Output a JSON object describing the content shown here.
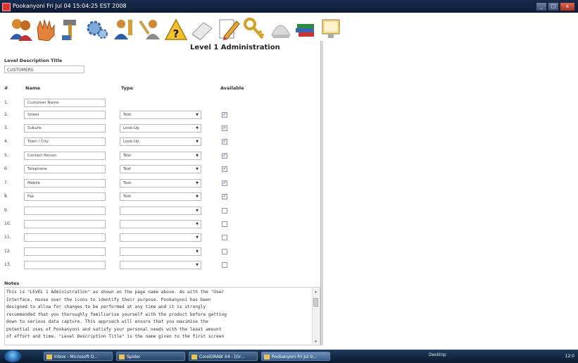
{
  "window": {
    "title": "Pookanyoni Fri Jul 04 15:04:25 EST 2008"
  },
  "toolbar": {
    "icons": [
      {
        "name": "users-icon"
      },
      {
        "name": "hand-icon"
      },
      {
        "name": "hammer-icon"
      },
      {
        "name": "gears-icon"
      },
      {
        "name": "user-gear-icon"
      },
      {
        "name": "user-tools-icon"
      },
      {
        "name": "help-warning-icon"
      },
      {
        "name": "eraser-icon"
      },
      {
        "name": "notepad-pencil-icon"
      },
      {
        "name": "key-icon"
      },
      {
        "name": "globe-icon"
      },
      {
        "name": "books-icon"
      },
      {
        "name": "monitor-icon"
      }
    ]
  },
  "page": {
    "title": "Level 1 Administration",
    "level_description_label": "Level Description Title",
    "level_description_value": "CUSTOMERS",
    "columns": {
      "num": "#",
      "name": "Name",
      "type": "Type",
      "available": "Available"
    }
  },
  "rows": [
    {
      "num": "1.",
      "name": "Customer Name",
      "type": "",
      "available": null
    },
    {
      "num": "2.",
      "name": "Street",
      "type": "Text",
      "available": true
    },
    {
      "num": "3.",
      "name": "Suburb",
      "type": "Look-Up",
      "available": true
    },
    {
      "num": "4.",
      "name": "Town / City",
      "type": "Look-Up",
      "available": true
    },
    {
      "num": "5.",
      "name": "Contact Person",
      "type": "Text",
      "available": true
    },
    {
      "num": "6.",
      "name": "Telephone",
      "type": "Text",
      "available": true
    },
    {
      "num": "7.",
      "name": "Mobile",
      "type": "Text",
      "available": true
    },
    {
      "num": "8.",
      "name": "Fax",
      "type": "Text",
      "available": true
    },
    {
      "num": "9.",
      "name": "",
      "type": "",
      "available": false
    },
    {
      "num": "10.",
      "name": "",
      "type": "",
      "available": false
    },
    {
      "num": "11.",
      "name": "",
      "type": "",
      "available": false
    },
    {
      "num": "12.",
      "name": "",
      "type": "",
      "available": false
    },
    {
      "num": "13.",
      "name": "",
      "type": "",
      "available": false
    }
  ],
  "notes": {
    "label": "Notes",
    "lines": [
      "This is \"LEVEL 1 Administration\" as shown on the page name above. As with the \"User",
      "Interface, mouse over the icons to identify their purpose. Pookanyoni has been",
      "designed to allow for changes to be performed at any time and it is strongly",
      "recommended that you thoroughly familiarise yourself with the product before getting",
      "down to serious data capture. This approach will ensure that you maximise the",
      "potential uses of Pookanyoni and satisfy your personal needs with the least amount",
      "of effort and time.  \"Level Description Title\" is the name given to the first screen"
    ]
  },
  "taskbar": {
    "tasks": [
      {
        "label": "Inbox - Microsoft O...",
        "active": false
      },
      {
        "label": "Spider",
        "active": false
      },
      {
        "label": "CorelDRAW X4 - [Gr...",
        "active": false
      },
      {
        "label": "Pookanyoni Fri Jul 0...",
        "active": true
      }
    ],
    "desktop_label": "Desktop",
    "clock": "12:0"
  }
}
